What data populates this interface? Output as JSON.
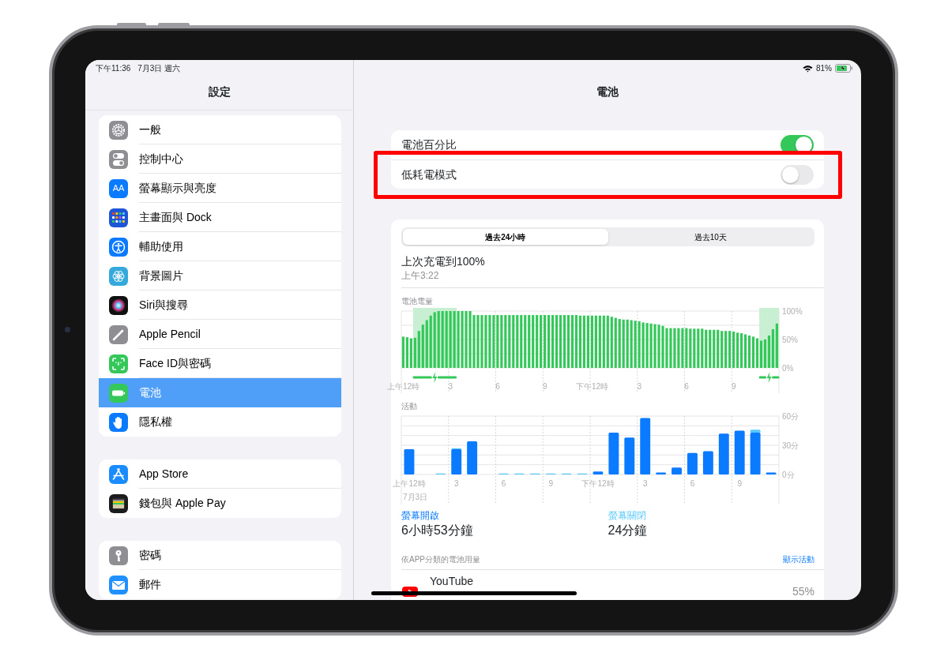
{
  "status_bar": {
    "time": "下午11:36",
    "date": "7月3日 週六",
    "battery_percent": "81%",
    "charging": true
  },
  "sidebar": {
    "title": "設定",
    "groups": [
      {
        "items": [
          {
            "label": "一般",
            "selected": false
          },
          {
            "label": "控制中心",
            "selected": false
          },
          {
            "label": "螢幕顯示與亮度",
            "selected": false,
            "icon_text": "AA"
          },
          {
            "label": "主畫面與 Dock",
            "selected": false
          },
          {
            "label": "輔助使用",
            "selected": false
          },
          {
            "label": "背景圖片",
            "selected": false
          },
          {
            "label": "Siri與搜尋",
            "selected": false
          },
          {
            "label": "Apple Pencil",
            "selected": false
          },
          {
            "label": "Face ID與密碼",
            "selected": false
          },
          {
            "label": "電池",
            "selected": true
          },
          {
            "label": "隱私權",
            "selected": false
          }
        ]
      },
      {
        "items": [
          {
            "label": "App Store",
            "selected": false
          },
          {
            "label": "錢包與 Apple Pay",
            "selected": false
          }
        ]
      },
      {
        "items": [
          {
            "label": "密碼",
            "selected": false
          },
          {
            "label": "郵件",
            "selected": false
          }
        ]
      }
    ]
  },
  "detail": {
    "title": "電池",
    "settings": [
      {
        "label": "電池百分比",
        "on": true,
        "highlighted": false
      },
      {
        "label": "低耗電模式",
        "on": false,
        "highlighted": true
      }
    ],
    "range_tabs": [
      {
        "label": "過去24小時",
        "selected": true
      },
      {
        "label": "過去10天",
        "selected": false
      }
    ],
    "last_charge": {
      "title": "上次充電到100%",
      "time": "上午3:22"
    },
    "battery_chart": {
      "chart_data": {
        "type": "bar",
        "title": "電池電量",
        "categories": [
          "上午12時",
          null,
          null,
          null,
          null,
          null,
          null,
          null,
          null,
          null,
          null,
          null,
          "3",
          null,
          null,
          null,
          null,
          null,
          null,
          null,
          null,
          null,
          null,
          null,
          "6",
          null,
          null,
          null,
          null,
          null,
          null,
          null,
          null,
          null,
          null,
          null,
          "9",
          null,
          null,
          null,
          null,
          null,
          null,
          null,
          null,
          null,
          null,
          null,
          "下午12時",
          null,
          null,
          null,
          null,
          null,
          null,
          null,
          null,
          null,
          null,
          null,
          "3",
          null,
          null,
          null,
          null,
          null,
          null,
          null,
          null,
          null,
          null,
          null,
          "6",
          null,
          null,
          null,
          null,
          null,
          null,
          null,
          null,
          null,
          null,
          null,
          "9",
          null,
          null,
          null,
          null,
          null,
          null,
          null,
          null,
          null,
          null,
          null
        ],
        "series": [
          {
            "color": "#34c759",
            "values": [
              55,
              54,
              52,
              53,
              65,
              76,
              84,
              92,
              98,
              100,
              100,
              100,
              100,
              100,
              100,
              100,
              100,
              100,
              93,
              93,
              93,
              93,
              93,
              93,
              93,
              93,
              93,
              93,
              93,
              93,
              93,
              93,
              93,
              93,
              93,
              93,
              93,
              93,
              93,
              93,
              93,
              93,
              93,
              93,
              93,
              92,
              92,
              92,
              92,
              92,
              92,
              92,
              92,
              90,
              88,
              86,
              85,
              85,
              84,
              83,
              82,
              80,
              79,
              78,
              77,
              76,
              74,
              70,
              70,
              70,
              70,
              70,
              70,
              69,
              69,
              69,
              69,
              67,
              67,
              67,
              67,
              65,
              65,
              65,
              64,
              62,
              61,
              59,
              57,
              55,
              52,
              48,
              50,
              57,
              68,
              78
            ]
          }
        ],
        "ylim": [
          0,
          100
        ],
        "yticks": [
          {
            "value": 0,
            "label": "0%"
          },
          {
            "value": 50,
            "label": "50%"
          },
          {
            "value": 100,
            "label": "100%"
          }
        ]
      },
      "charging": [
        false,
        false,
        false,
        true,
        true,
        true,
        true,
        true,
        true,
        true,
        true,
        true,
        true,
        true,
        false,
        false,
        false,
        false,
        false,
        false,
        false,
        false,
        false,
        false,
        false,
        false,
        false,
        false,
        false,
        false,
        false,
        false,
        false,
        false,
        false,
        false,
        false,
        false,
        false,
        false,
        false,
        false,
        false,
        false,
        false,
        false,
        false,
        false,
        false,
        false,
        false,
        false,
        false,
        false,
        false,
        false,
        false,
        false,
        false,
        false,
        false,
        false,
        false,
        false,
        false,
        false,
        false,
        false,
        false,
        false,
        false,
        false,
        false,
        false,
        false,
        false,
        false,
        false,
        false,
        false,
        false,
        false,
        false,
        false,
        false,
        false,
        false,
        false,
        false,
        false,
        false,
        true,
        true,
        true,
        true,
        true
      ]
    },
    "activity_chart": {
      "date_label": "7月3日",
      "chart_data": {
        "type": "bar",
        "title": "活動",
        "stacked": true,
        "categories": [
          "上午12時",
          null,
          null,
          "3",
          null,
          null,
          "6",
          null,
          null,
          "9",
          null,
          null,
          "下午12時",
          null,
          null,
          "3",
          null,
          null,
          "6",
          null,
          null,
          "9",
          null,
          null
        ],
        "ylim": [
          0,
          60
        ],
        "series": [
          {
            "name": "螢幕開啟",
            "color": "#0a7aff",
            "values": [
              26,
              0,
              0,
              26,
              34,
              0,
              0,
              0,
              0,
              0,
              0,
              0,
              3,
              43,
              38,
              58,
              2,
              7,
              22,
              24,
              42,
              45,
              43,
              2
            ]
          },
          {
            "name": "螢幕關閉",
            "color": "#5ac8fa",
            "values": [
              0,
              0,
              1,
              1,
              0,
              0,
              1,
              1,
              1,
              1,
              1,
              1,
              0,
              0,
              0,
              0,
              0,
              0,
              0,
              0,
              0,
              0,
              3,
              0
            ]
          }
        ],
        "yticks": [
          {
            "value": 0,
            "label": "0分"
          },
          {
            "value": 30,
            "label": "30分"
          },
          {
            "value": 60,
            "label": "60分"
          }
        ]
      }
    },
    "screen_stats": [
      {
        "value": "6小時53分鐘"
      },
      {
        "value": "24分鐘"
      }
    ],
    "app_usage": {
      "title": "依APP分類的電池用量",
      "action": "顯示活動",
      "apps": [
        {
          "name": "YouTube",
          "percent": "55%"
        }
      ]
    }
  }
}
